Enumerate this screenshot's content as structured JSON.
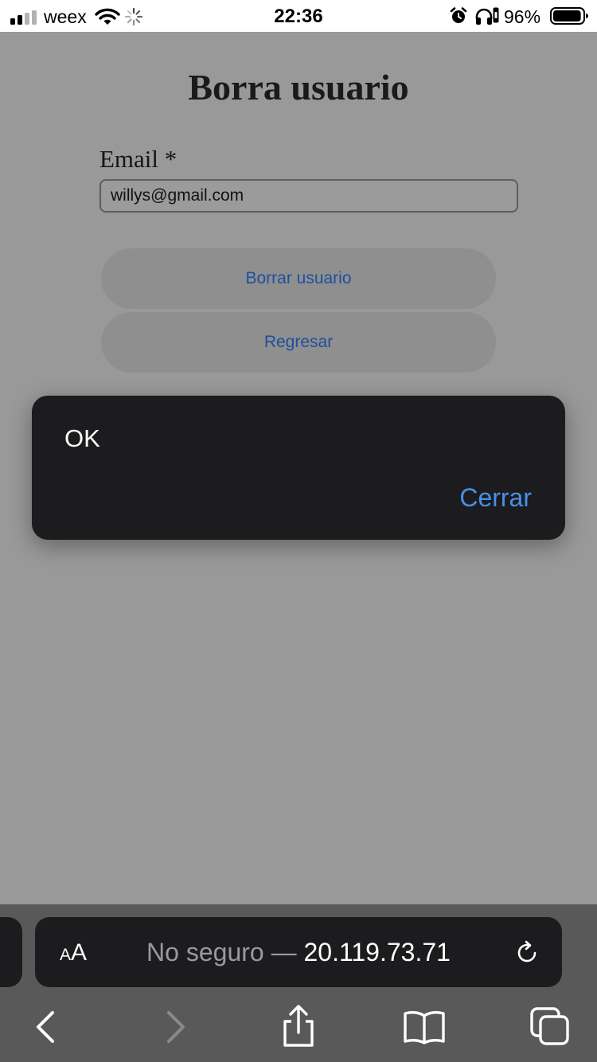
{
  "status_bar": {
    "carrier": "weex",
    "time": "22:36",
    "battery_percent": "96%",
    "signal_bars_active": 2,
    "signal_bars_total": 4,
    "battery_level": 0.96
  },
  "page": {
    "title": "Borra usuario",
    "email_label": "Email *",
    "email_value": "willys@gmail.com",
    "delete_button_label": "Borrar usuario",
    "back_button_label": "Regresar"
  },
  "dialog": {
    "message": "OK",
    "close_label": "Cerrar"
  },
  "browser": {
    "text_size_small": "A",
    "text_size_big": "A",
    "security_label": "No seguro",
    "separator": "—",
    "host": "20.119.73.71"
  },
  "colors": {
    "backdrop": "#999999",
    "dialog_background": "#1c1c1e",
    "link_blue": "#4a8eea",
    "button_text_blue": "#1f4f9e"
  },
  "icons": [
    "signal-icon",
    "wifi-icon",
    "activity-spinner-icon",
    "alarm-icon",
    "headphones-icon",
    "rotation-lock-icon",
    "battery-icon",
    "reload-icon",
    "back-icon",
    "forward-icon",
    "share-icon",
    "bookmarks-icon",
    "tabs-icon"
  ]
}
